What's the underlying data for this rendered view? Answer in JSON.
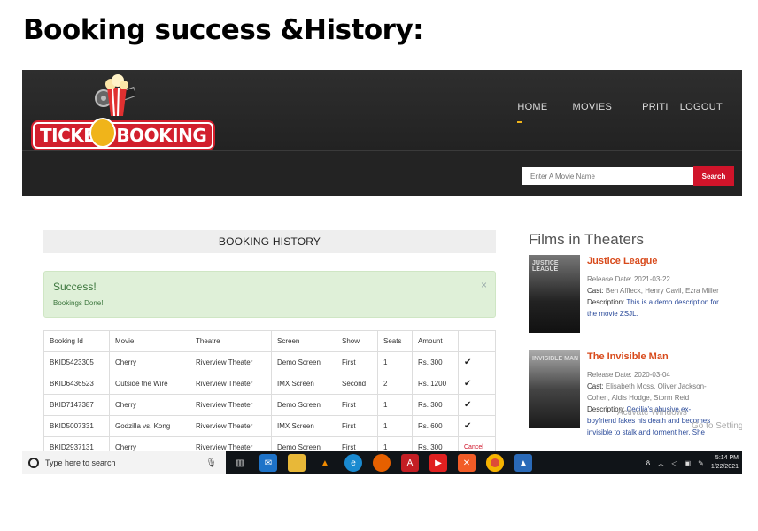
{
  "slide_title": "Booking success &History:",
  "header": {
    "logo_left": "TICKE",
    "logo_right": "BOOKING",
    "nav": [
      "HOME",
      "MOVIES",
      "PRITI",
      "LOGOUT"
    ],
    "search_placeholder": "Enter A Movie Name",
    "search_button": "Search"
  },
  "booking_history": {
    "heading": "BOOKING HISTORY",
    "alert_title": "Success!",
    "alert_text": "Bookings Done!",
    "alert_close": "×",
    "columns": [
      "Booking Id",
      "Movie",
      "Theatre",
      "Screen",
      "Show",
      "Seats",
      "Amount",
      ""
    ],
    "rows": [
      [
        "BKID5423305",
        "Cherry",
        "Riverview Theater",
        "Demo Screen",
        "First",
        "1",
        "Rs. 300",
        "✔"
      ],
      [
        "BKID6436523",
        "Outside the Wire",
        "Riverview Theater",
        "IMX Screen",
        "Second",
        "2",
        "Rs. 1200",
        "✔"
      ],
      [
        "BKID7147387",
        "Cherry",
        "Riverview Theater",
        "Demo Screen",
        "First",
        "1",
        "Rs. 300",
        "✔"
      ],
      [
        "BKID5007331",
        "Godzilla vs. Kong",
        "Riverview Theater",
        "IMX Screen",
        "First",
        "1",
        "Rs. 600",
        "✔"
      ],
      [
        "BKID2937131",
        "Cherry",
        "Riverview Theater",
        "Demo Screen",
        "First",
        "1",
        "Rs. 300",
        "Cancel"
      ]
    ]
  },
  "films": {
    "heading": "Films in Theaters",
    "items": [
      {
        "poster_label": "JUSTICE LEAGUE",
        "title": "Justice League",
        "release_label": "Release Date:",
        "release": "2021-03-22",
        "cast_label": "Cast:",
        "cast": "Ben Affleck, Henry Cavil, Ezra Miller",
        "desc_label": "Description:",
        "desc": "This is a demo description for the movie ZSJL."
      },
      {
        "poster_label": "INVISIBLE MAN",
        "title": "The Invisible Man",
        "release_label": "Release Date:",
        "release": "2020-03-04",
        "cast_label": "Cast:",
        "cast": "Elisabeth Moss, Oliver Jackson-Cohen, Aldis Hodge, Storm Reid",
        "desc_label": "Description:",
        "desc": "Cecilia's abusive ex-boyfriend fakes his death and becomes invisible to stalk and torment her. She"
      }
    ]
  },
  "watermark_line1": "Activate Windows",
  "watermark_line2": "Go to Settings to activate Windows.",
  "taskbar": {
    "search_placeholder": "Type here to search",
    "time": "5:14 PM",
    "date": "1/22/2021"
  },
  "colors": {
    "accent_red": "#d0142a",
    "nav_active": "#f0b41a",
    "film_title": "#d84a1b",
    "success_bg": "#dff0d8"
  }
}
